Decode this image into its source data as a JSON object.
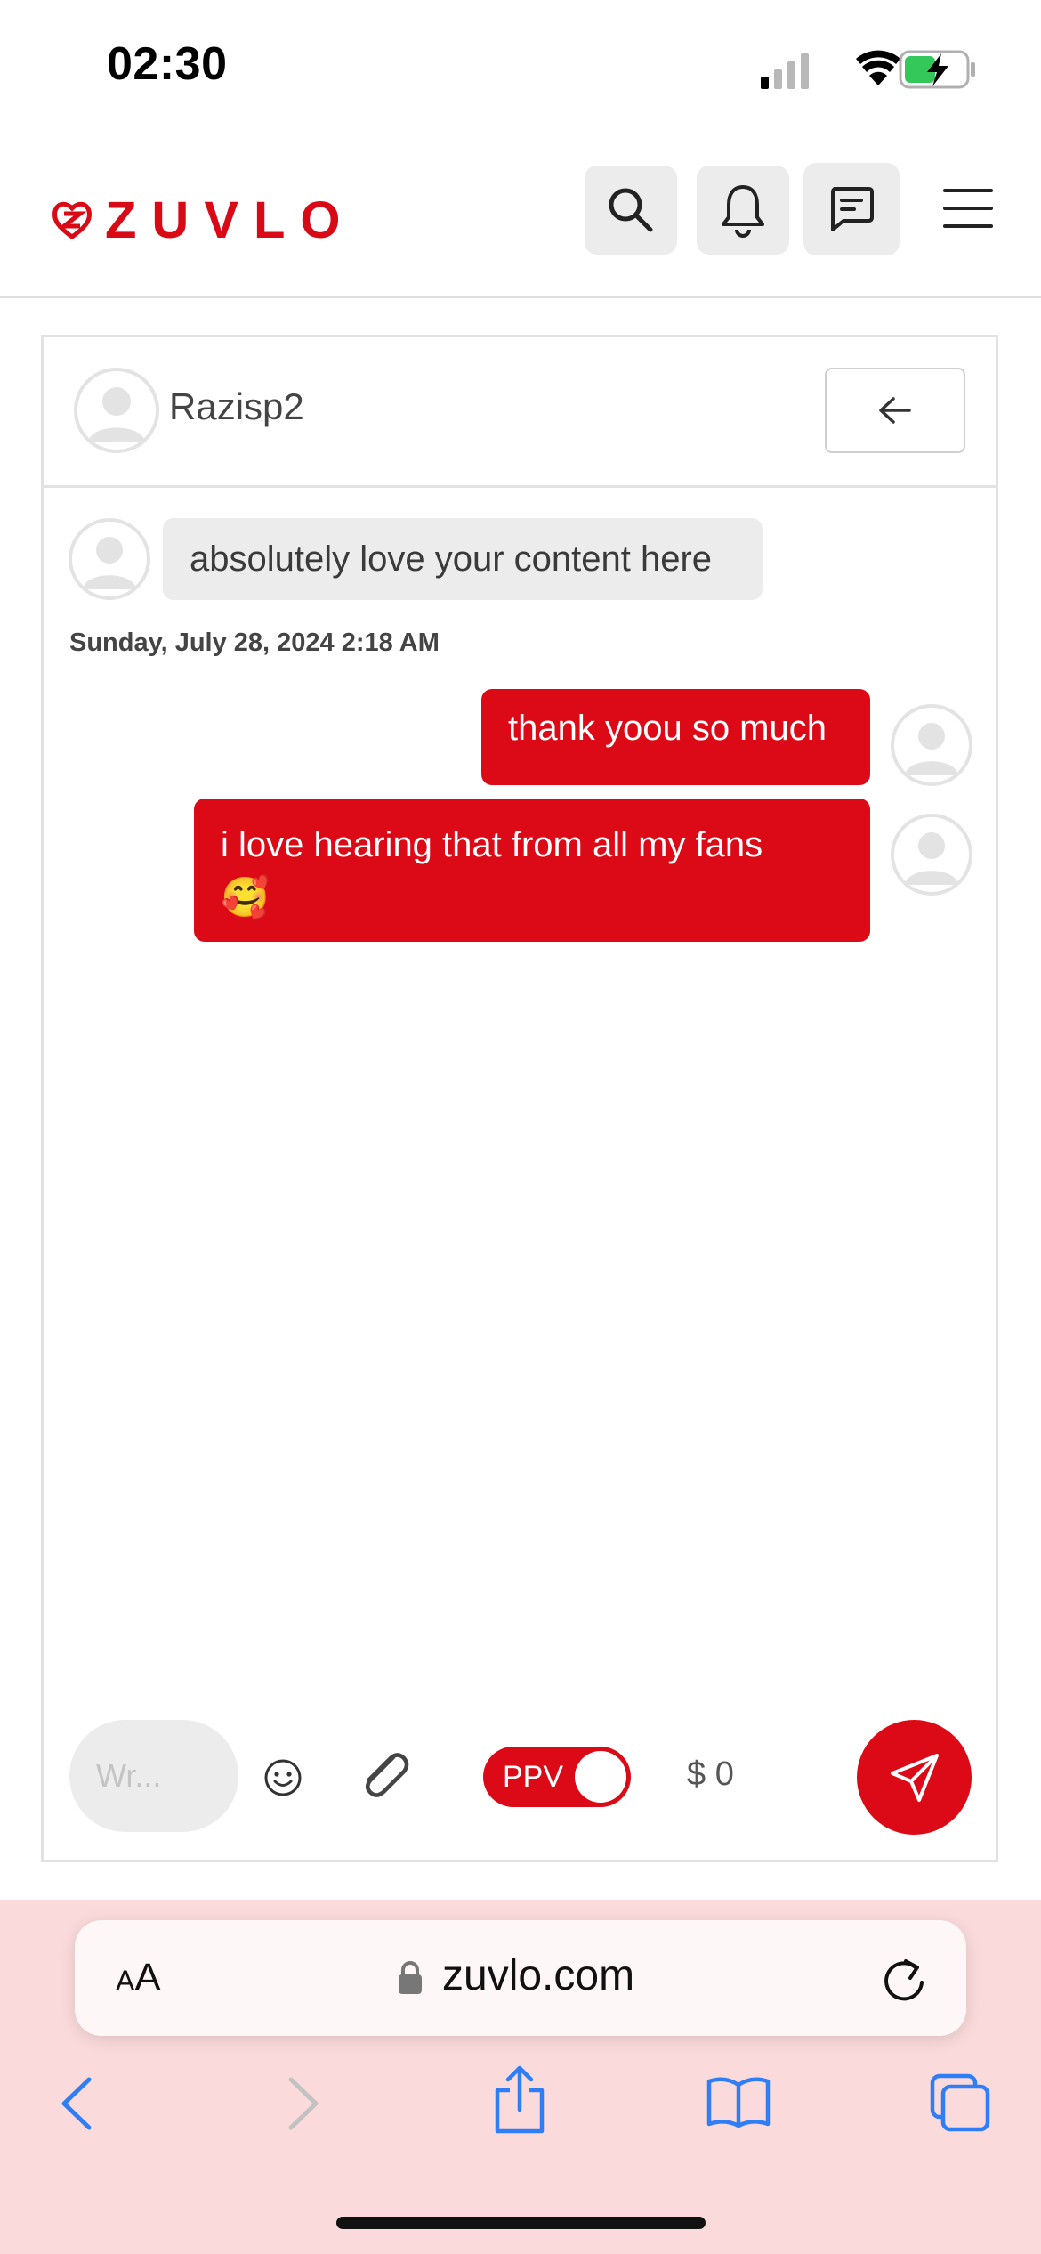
{
  "status_bar": {
    "time": "02:30"
  },
  "header": {
    "brand": "ZUVLO",
    "icons": [
      "search-icon",
      "bell-icon",
      "message-icon",
      "menu-icon"
    ]
  },
  "chat": {
    "contact_name": "Razisp2",
    "messages": [
      {
        "direction": "incoming",
        "text": "absolutely love your content here"
      },
      {
        "direction": "outgoing",
        "text": "thank yoou so much"
      },
      {
        "direction": "outgoing",
        "text": "i love hearing that from all my fans",
        "emoji": "🥰"
      }
    ],
    "timestamp": "Sunday, July 28, 2024 2:18 AM"
  },
  "composer": {
    "placeholder": "Wr...",
    "ppv_label": "PPV",
    "ppv_on": true,
    "price": "$ 0"
  },
  "browser": {
    "text_size_label_small": "A",
    "text_size_label_large": "A",
    "url": "zuvlo.com"
  },
  "colors": {
    "brand": "#dc0a16",
    "bubble_in": "#ececec",
    "safari_bg": "#fadada",
    "ios_blue": "#2f7ef5"
  }
}
